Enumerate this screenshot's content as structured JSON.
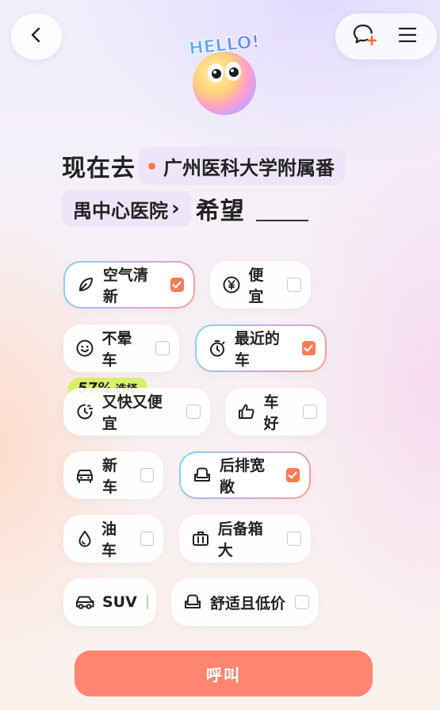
{
  "header": {
    "back_icon": "chevron-left-icon",
    "chat_icon": "chat-add-icon",
    "menu_icon": "menu-icon"
  },
  "mascot": {
    "text": "HELLO!"
  },
  "destination": {
    "prefix": "现在去",
    "place_line1": "广州医科大学附属番",
    "place_line2": "禺中心医院",
    "chevron": "›",
    "suffix": "希望"
  },
  "badge": {
    "percent": "57%",
    "word": "选择"
  },
  "tags": [
    {
      "label": "空气清新",
      "icon": "leaf-icon",
      "checked": true
    },
    {
      "label": "便宜",
      "icon": "yen-icon",
      "checked": false
    },
    {
      "label": "不晕车",
      "icon": "smile-icon",
      "checked": false
    },
    {
      "label": "最近的车",
      "icon": "timer-icon",
      "checked": true
    },
    {
      "label": "又快又便宜",
      "icon": "fast-clock-icon",
      "checked": false
    },
    {
      "label": "车好",
      "icon": "thumbs-up-icon",
      "checked": false
    },
    {
      "label": "新车",
      "icon": "car-icon",
      "checked": false
    },
    {
      "label": "后排宽敞",
      "icon": "seat-icon",
      "checked": true
    },
    {
      "label": "油车",
      "icon": "drop-icon",
      "checked": false
    },
    {
      "label": "后备箱大",
      "icon": "luggage-icon",
      "checked": false
    },
    {
      "label": "SUV",
      "icon": "suv-icon",
      "checked": false
    },
    {
      "label": "舒适且低价",
      "icon": "seat-icon",
      "checked": false
    }
  ],
  "call_button": {
    "label": "呼叫"
  },
  "colors": {
    "accent": "#ff7a55",
    "call_button": "#ff8570",
    "badge": "#d8f06a",
    "dot": "#ff7a3c"
  }
}
